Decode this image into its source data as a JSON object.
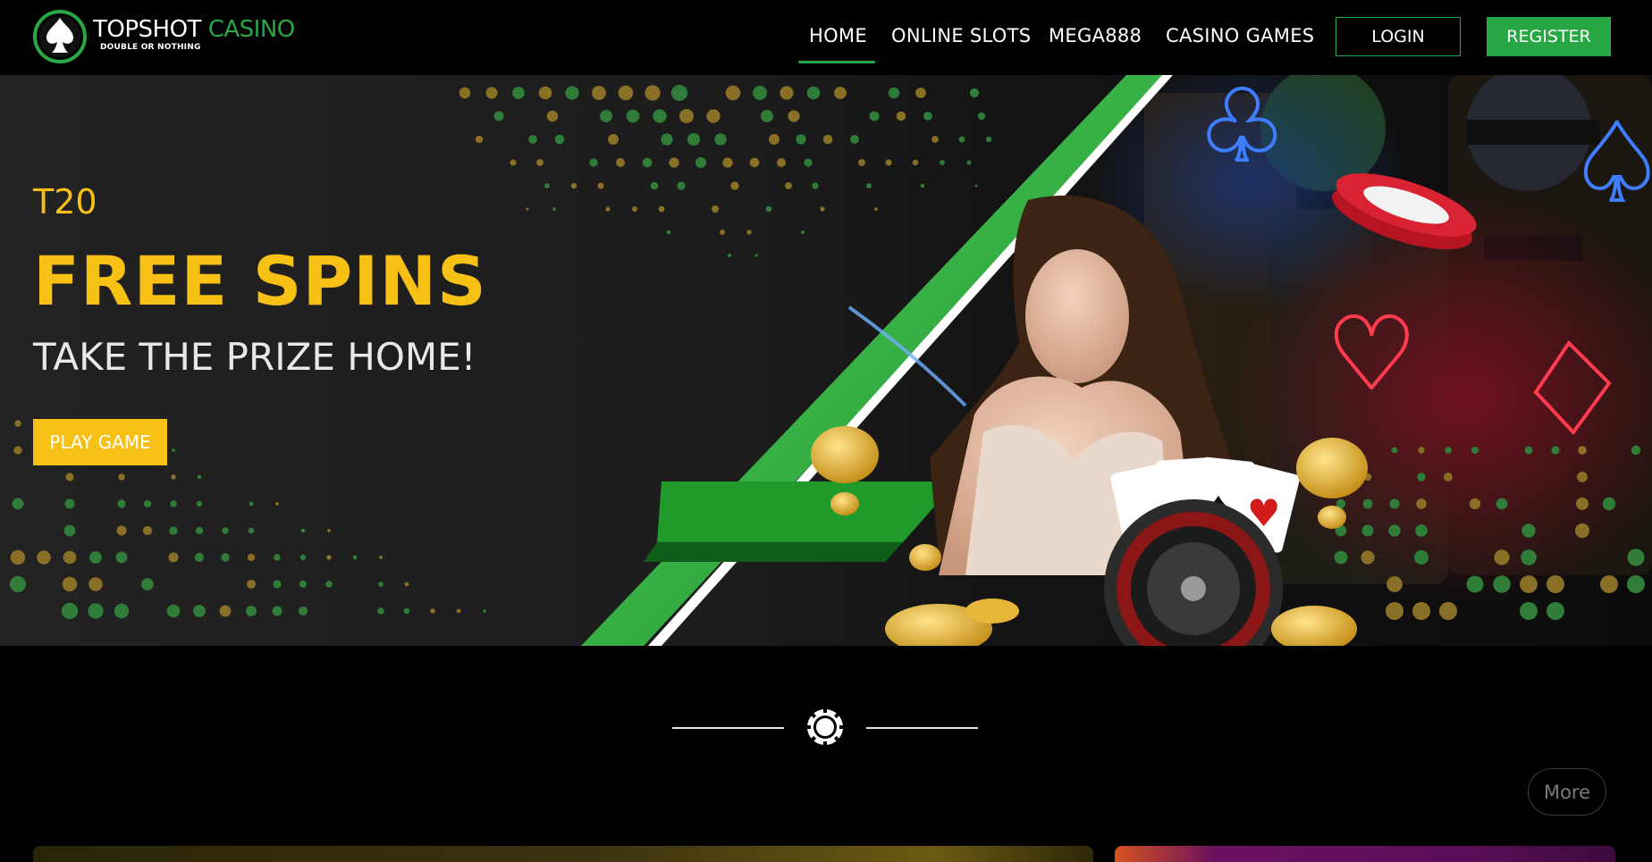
{
  "brand": {
    "name_part1": "TOPSHOT",
    "name_part2": "CASINO",
    "tagline": "DOUBLE OR NOTHING",
    "accent_color": "#27a844",
    "highlight_color": "#f7c014"
  },
  "nav": {
    "items": [
      {
        "label": "HOME",
        "active": true
      },
      {
        "label": "ONLINE SLOTS",
        "active": false
      },
      {
        "label": "MEGA888",
        "active": false
      },
      {
        "label": "CASINO GAMES",
        "active": false
      }
    ],
    "login_label": "LOGIN",
    "register_label": "REGISTER"
  },
  "hero": {
    "subtitle": "T20",
    "title": "FREE SPINS",
    "tagline": "TAKE THE PRIZE HOME!",
    "cta_label": "PLAY GAME"
  },
  "section": {
    "divider_icon": "poker-chip-icon",
    "more_label": "More"
  }
}
